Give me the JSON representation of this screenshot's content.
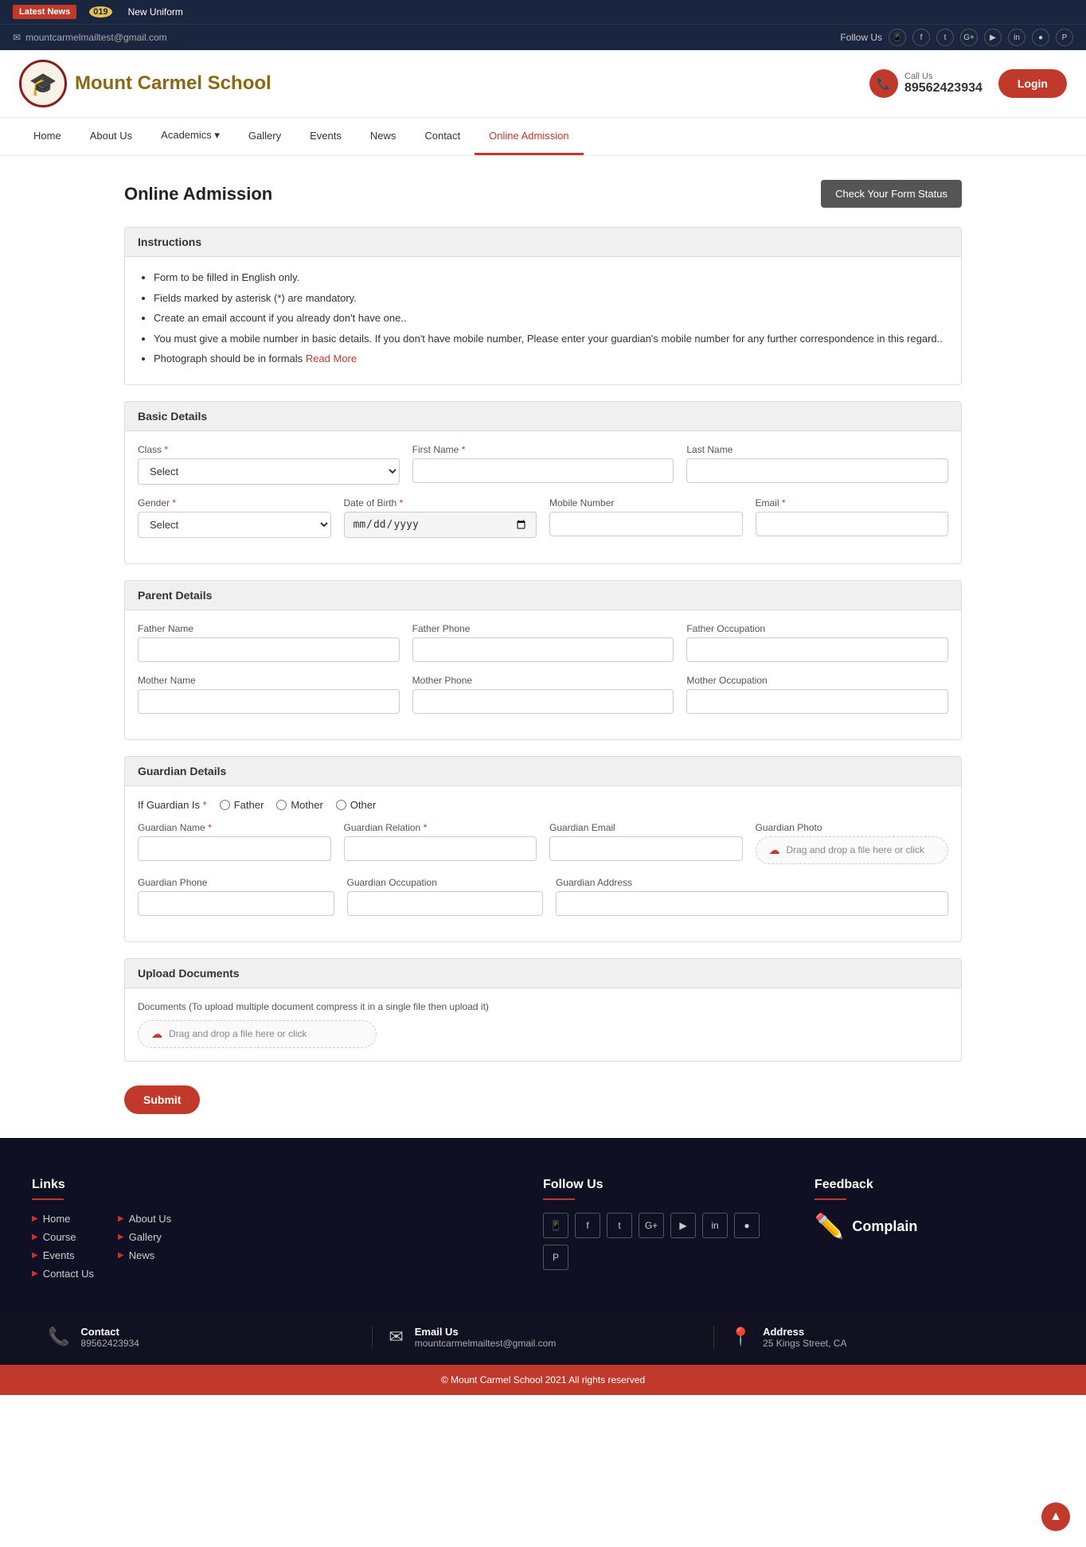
{
  "topbar": {
    "latest_news": "Latest News",
    "badge": "019",
    "news_item": "New Uniform",
    "email": "mountcarmelmailtest@gmail.com",
    "follow_us": "Follow Us"
  },
  "header": {
    "school_name": "Mount Carmel School",
    "call_us_label": "Call Us",
    "phone": "89562423934",
    "login_label": "Login"
  },
  "nav": {
    "items": [
      {
        "label": "Home",
        "active": false
      },
      {
        "label": "About Us",
        "active": false
      },
      {
        "label": "Academics",
        "active": false,
        "has_dropdown": true
      },
      {
        "label": "Gallery",
        "active": false
      },
      {
        "label": "Events",
        "active": false
      },
      {
        "label": "News",
        "active": false
      },
      {
        "label": "Contact",
        "active": false
      },
      {
        "label": "Online Admission",
        "active": true
      }
    ]
  },
  "page": {
    "title": "Online Admission",
    "check_status_btn": "Check Your Form Status"
  },
  "instructions": {
    "header": "Instructions",
    "items": [
      "Form to be filled in English only.",
      "Fields marked by asterisk (*) are mandatory.",
      "Create an email account if you already don't have one..",
      "You must give a mobile number in basic details. If you don't have mobile number, Please enter your guardian's mobile number for any further correspondence in this regard..",
      "Photograph should be in formals"
    ],
    "read_more": "Read More"
  },
  "basic_details": {
    "header": "Basic Details",
    "class_label": "Class",
    "class_placeholder": "Select",
    "first_name_label": "First Name",
    "last_name_label": "Last Name",
    "gender_label": "Gender",
    "gender_placeholder": "Select",
    "dob_label": "Date of Birth",
    "mobile_label": "Mobile Number",
    "email_label": "Email"
  },
  "parent_details": {
    "header": "Parent Details",
    "father_name_label": "Father Name",
    "father_phone_label": "Father Phone",
    "father_occupation_label": "Father Occupation",
    "mother_name_label": "Mother Name",
    "mother_phone_label": "Mother Phone",
    "mother_occupation_label": "Mother Occupation"
  },
  "guardian_details": {
    "header": "Guardian Details",
    "if_guardian_is": "If Guardian Is",
    "radio_father": "Father",
    "radio_mother": "Mother",
    "radio_other": "Other",
    "guardian_name_label": "Guardian Name",
    "guardian_relation_label": "Guardian Relation",
    "guardian_email_label": "Guardian Email",
    "guardian_photo_label": "Guardian Photo",
    "guardian_photo_placeholder": "Drag and drop a file here or click",
    "guardian_phone_label": "Guardian Phone",
    "guardian_occupation_label": "Guardian Occupation",
    "guardian_address_label": "Guardian Address"
  },
  "upload_documents": {
    "header": "Upload Documents",
    "description": "Documents (To upload multiple document compress it in a single file then upload it)",
    "drag_drop_placeholder": "Drag and drop a file here or click"
  },
  "submit_btn": "Submit",
  "footer": {
    "links_header": "Links",
    "follow_header": "Follow Us",
    "feedback_header": "Feedback",
    "complain_label": "Complain",
    "links_col1": [
      {
        "label": "Home"
      },
      {
        "label": "Course"
      },
      {
        "label": "Events"
      },
      {
        "label": "Contact Us"
      }
    ],
    "links_col2": [
      {
        "label": "About Us"
      },
      {
        "label": "Gallery"
      },
      {
        "label": "News"
      }
    ],
    "contact_label": "Contact",
    "contact_number": "89562423934",
    "email_label": "Email Us",
    "email_value": "mountcarmelmailtest@gmail.com",
    "address_label": "Address",
    "address_value": "25 Kings Street, CA",
    "copyright": "© Mount Carmel School 2021 All rights reserved"
  }
}
